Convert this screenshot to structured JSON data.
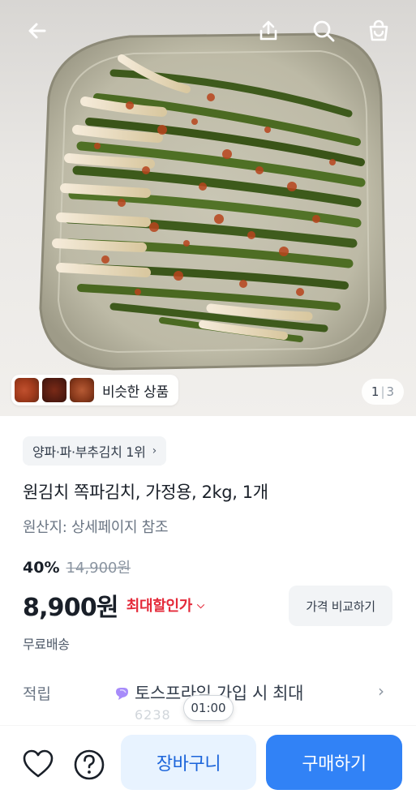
{
  "header": {
    "back_icon": "arrow-left-icon",
    "share_icon": "share-icon",
    "search_icon": "search-icon",
    "bag_icon": "shopping-bag-icon"
  },
  "gallery": {
    "similar_label": "비슷한 상품",
    "current_page": "1",
    "separator": "|",
    "total_pages": "3"
  },
  "product": {
    "rank_badge": "양파·파·부추김치 1위",
    "title": "원김치 쪽파김치, 가정용, 2kg, 1개",
    "origin": "원산지: 상세페이지 참조",
    "discount_rate": "40%",
    "original_price": "14,900원",
    "price": "8,900원",
    "max_discount_label": "최대할인가",
    "compare_label": "가격 비교하기",
    "shipping": "무료배송"
  },
  "points": {
    "label": "적립",
    "text": "토스프라임 가입 시 최대",
    "faded_text": "6238"
  },
  "timer": "01:00",
  "bottom_bar": {
    "heart_icon": "heart-icon",
    "help_icon": "question-circle-icon",
    "cart_label": "장바구니",
    "buy_label": "구매하기"
  },
  "colors": {
    "accent_blue": "#3182f6",
    "cart_bg": "#e8f3ff",
    "cart_text": "#1b64da",
    "discount_red": "#e42939"
  }
}
